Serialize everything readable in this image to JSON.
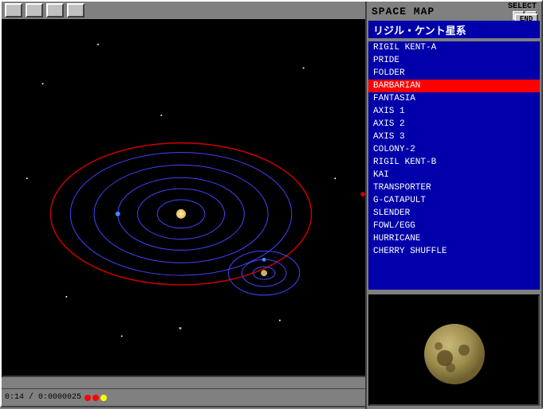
{
  "toolbar": {
    "buttons": [
      "",
      "",
      "",
      ""
    ]
  },
  "header": {
    "title": "SPACE MAP",
    "select_label": "SELECT",
    "up_arrow": "↑",
    "down_arrow": "↓",
    "end_label": "END"
  },
  "system": {
    "name": "リジル・ケント星系"
  },
  "locations": [
    {
      "id": 1,
      "label": "RIGIL KENT-A",
      "selected": false
    },
    {
      "id": 2,
      "label": "PRIDE",
      "selected": false
    },
    {
      "id": 3,
      "label": "FOLDER",
      "selected": false
    },
    {
      "id": 4,
      "label": "BARBARIAN",
      "selected": true
    },
    {
      "id": 5,
      "label": "FANTASIA",
      "selected": false
    },
    {
      "id": 6,
      "label": "AXIS 1",
      "selected": false
    },
    {
      "id": 7,
      "label": "AXIS 2",
      "selected": false
    },
    {
      "id": 8,
      "label": "AXIS 3",
      "selected": false
    },
    {
      "id": 9,
      "label": "COLONY-2",
      "selected": false
    },
    {
      "id": 10,
      "label": "RIGIL KENT-B",
      "selected": false
    },
    {
      "id": 11,
      "label": "KAI",
      "selected": false
    },
    {
      "id": 12,
      "label": "TRANSPORTER",
      "selected": false
    },
    {
      "id": 13,
      "label": "G-CATAPULT",
      "selected": false
    },
    {
      "id": 14,
      "label": "SLENDER",
      "selected": false
    },
    {
      "id": 15,
      "label": "FOWL/EGG",
      "selected": false
    },
    {
      "id": 16,
      "label": "HURRICANE",
      "selected": false
    },
    {
      "id": 17,
      "label": "CHERRY SHUFFLE",
      "selected": false
    }
  ],
  "status": {
    "coords": "0:14 / 0:0000025",
    "indicator_colors": [
      "#ff0000",
      "#ff0000",
      "#ffff00"
    ]
  },
  "icons": {
    "scroll_up": "▲",
    "scroll_down": "▼",
    "arrow_up": "↑",
    "arrow_down": "↓"
  }
}
